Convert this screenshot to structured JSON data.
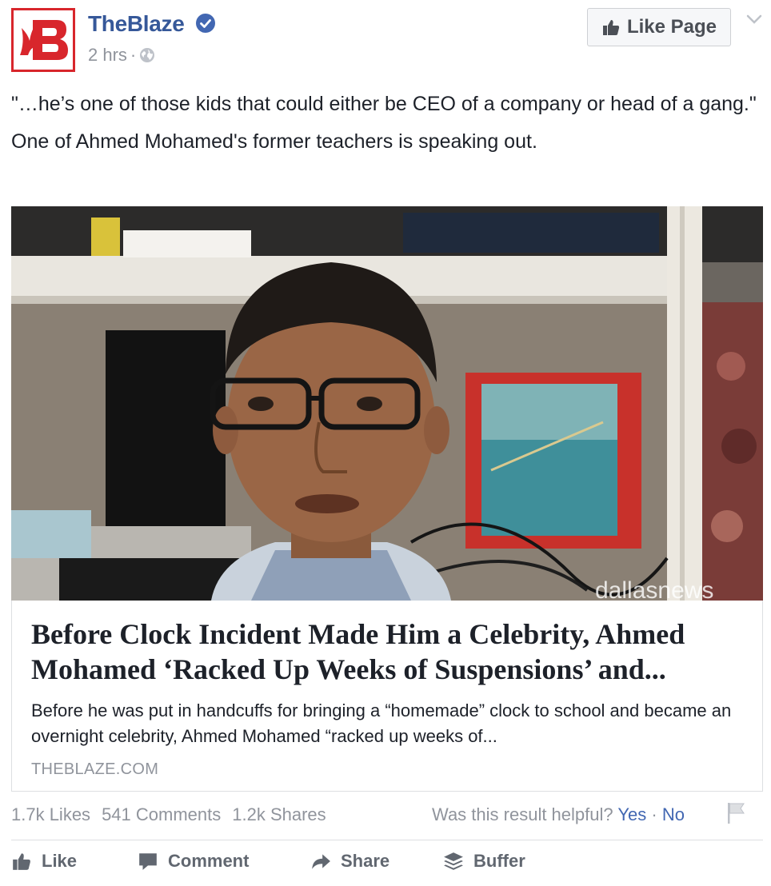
{
  "post": {
    "page_name": "TheBlaze",
    "time": "2 hrs",
    "separator": "·",
    "like_page_label": "Like Page",
    "quote": "\"…he’s one of those kids that could either be CEO of a company or head of a gang.\"",
    "message": "One of Ahmed Mohamed's former teachers is speaking out."
  },
  "link_card": {
    "image_watermark": "dallasnews",
    "title": "Before Clock Incident Made Him a Celebrity, Ahmed Mohamed ‘Racked Up Weeks of Suspensions’ and...",
    "description": "Before he was put in handcuffs for bringing a “homemade” clock to school and became an overnight celebrity, Ahmed Mohamed “racked up weeks of...",
    "domain": "THEBLAZE.COM"
  },
  "stats": {
    "likes": "1.7k Likes",
    "comments": "541 Comments",
    "shares": "1.2k Shares"
  },
  "feedback": {
    "question": "Was this result helpful?",
    "yes": "Yes",
    "separator": "·",
    "no": "No"
  },
  "actions": {
    "like": "Like",
    "comment": "Comment",
    "share": "Share",
    "buffer": "Buffer"
  },
  "colors": {
    "link_blue": "#365899",
    "brand_red": "#d8262c",
    "muted_gray": "#90949c"
  },
  "icons": [
    "blaze-logo",
    "verified-badge-icon",
    "globe-icon",
    "thumbs-up-icon",
    "chevron-down-icon",
    "flag-icon",
    "comment-icon",
    "share-arrow-icon",
    "buffer-stack-icon"
  ]
}
